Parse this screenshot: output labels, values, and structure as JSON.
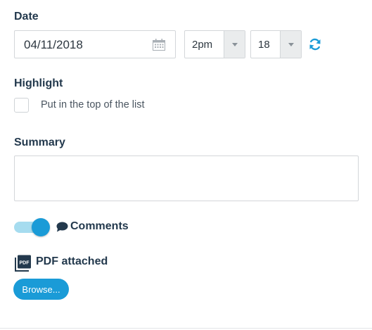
{
  "date_section": {
    "label": "Date",
    "date_value": "04/11/2018",
    "hour_value": "2pm",
    "minute_value": "18"
  },
  "highlight_section": {
    "label": "Highlight",
    "checkbox_label": "Put in the top of the list",
    "checked": false
  },
  "summary_section": {
    "label": "Summary",
    "value": ""
  },
  "comments_section": {
    "label": "Comments",
    "enabled": true
  },
  "attachment_section": {
    "label": "PDF attached",
    "browse_label": "Browse...",
    "pdf_icon_text": "PDF"
  },
  "colors": {
    "accent": "#1a9bd7",
    "toggle_track": "#a6dcef",
    "heading": "#23394d"
  },
  "icons": {
    "calendar": "calendar-icon",
    "refresh": "refresh-icon",
    "comment": "comment-icon",
    "pdf": "pdf-icon"
  }
}
